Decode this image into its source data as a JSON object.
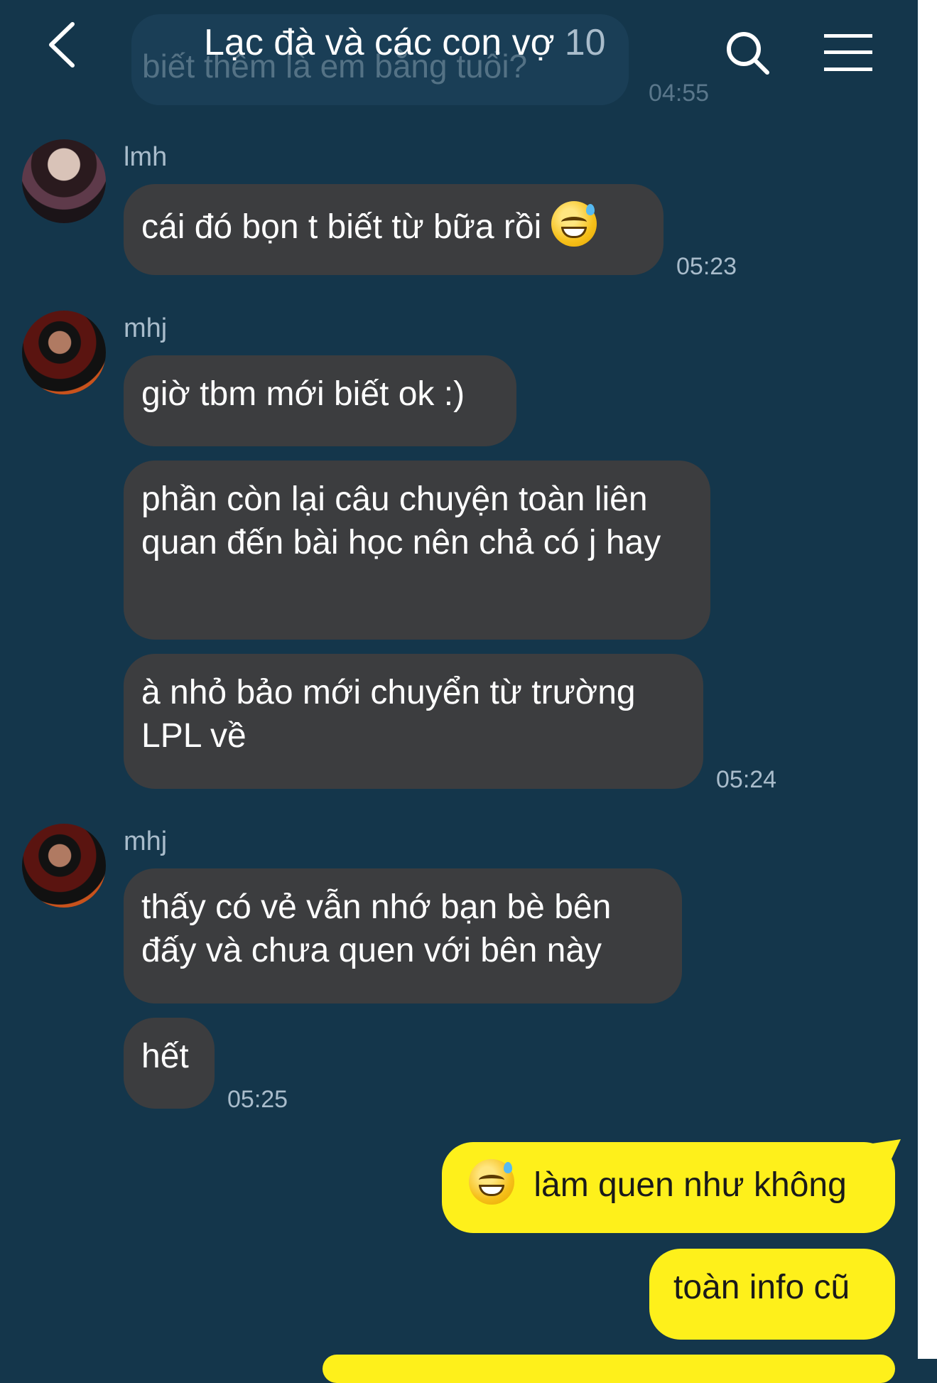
{
  "header": {
    "title": "Lạc đà và các con vợ",
    "member_count": "10",
    "back_icon": "chevron-left-icon",
    "search_icon": "search-icon",
    "menu_icon": "hamburger-menu-icon"
  },
  "ghost": {
    "text": "biết thêm là em bằng tuổi?",
    "time": "04:55"
  },
  "messages": [
    {
      "sender": "lmh",
      "text": "cái đó bọn t biết từ bữa rồi",
      "time": "05:23"
    },
    {
      "sender": "mhj",
      "text": "giờ tbm mới biết ok :)"
    },
    {
      "text": "phần còn lại câu chuyện toàn liên quan đến bài học nên chả có j hay"
    },
    {
      "text": "à nhỏ bảo mới chuyển từ trường LPL về",
      "time": "05:24"
    },
    {
      "sender": "mhj",
      "text": "thấy có vẻ vẫn nhớ bạn bè bên đấy và chưa quen với bên này"
    },
    {
      "text": "hết",
      "time": "05:25"
    }
  ],
  "my_messages": [
    {
      "text": "làm quen như không"
    },
    {
      "text": "toàn info cũ"
    }
  ],
  "colors": {
    "background": "#14364b",
    "incoming_bubble": "#3c3d3f",
    "outgoing_bubble": "#fef01b",
    "secondary_text": "#a9bccb"
  }
}
